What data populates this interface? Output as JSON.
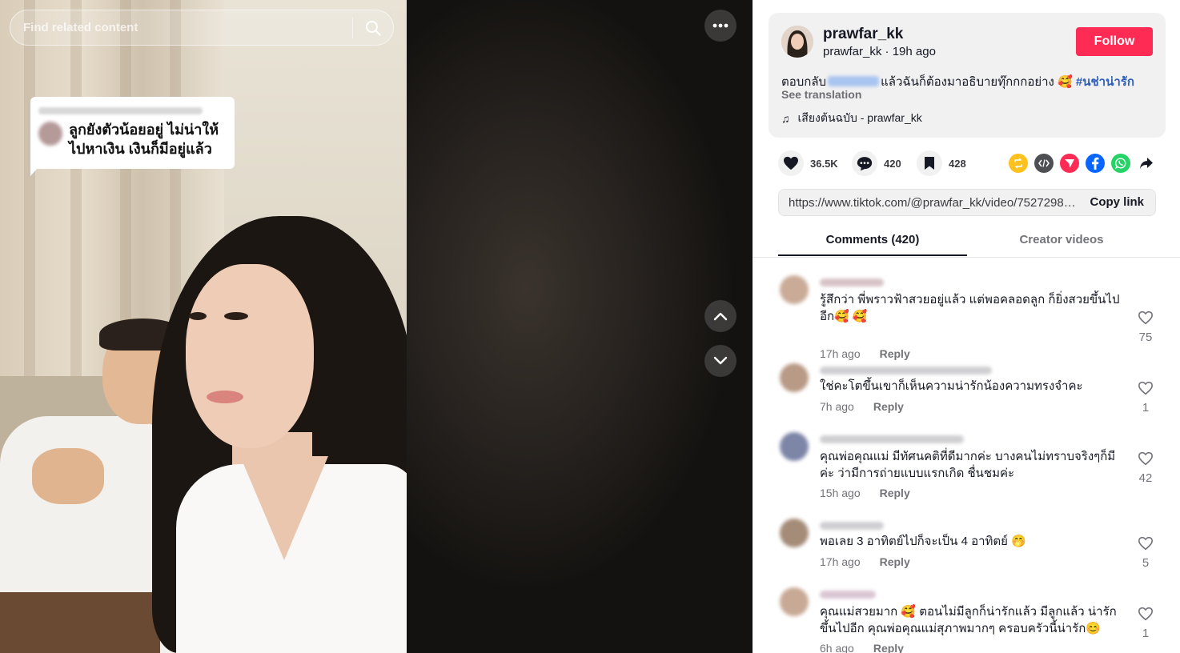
{
  "search": {
    "placeholder": "Find related content"
  },
  "overlay": {
    "comment_text": "ลูกยังตัวน้อยอยู่ ไม่น่าให้ไปหาเงิน เงินก็มีอยู่แล้ว"
  },
  "author": {
    "name": "prawfar_kk",
    "handle": "prawfar_kk",
    "separator": "·",
    "posted": "19h ago",
    "follow_label": "Follow"
  },
  "description": {
    "caption_prefix": "ตอบกลับ",
    "caption_body": "แล้วฉันก็ต้องมาอธิบายทุ๊กกกอย่าง 🥰",
    "hashtag": "#นช่าน่ารัก",
    "see_translation": "See translation",
    "music_icon": "♫",
    "music": "เสียงต้นฉบับ - prawfar_kk"
  },
  "stats": {
    "likes": "36.5K",
    "comments": "420",
    "saves": "428"
  },
  "share": {
    "icons": [
      "repost-icon",
      "embed-icon",
      "send-icon",
      "facebook-icon",
      "whatsapp-icon",
      "share-arrow-icon"
    ],
    "colors": {
      "repost": "#fec11d",
      "embed": "#4e4e55",
      "send": "#fe2c55",
      "facebook": "#0866ff",
      "whatsapp": "#25d366"
    }
  },
  "link": {
    "url": "https://www.tiktok.com/@prawfar_kk/video/75272989...",
    "copy_label": "Copy link"
  },
  "tabs": {
    "comments": "Comments (420)",
    "creator": "Creator videos"
  },
  "comments": [
    {
      "text": "รู้สึกว่า พี่พราวฟ้าสวยอยู่แล้ว แต่พอคลอดลูก ก็ยิ่งสวยขึ้นไปอีก🥰 🥰",
      "time": "17h ago",
      "reply": "Reply",
      "likes": "75"
    },
    {
      "text": "ใช่คะโตขึ้นเขาก็เห็นความน่ารักน้องความทรงจำคะ",
      "time": "7h ago",
      "reply": "Reply",
      "likes": "1"
    },
    {
      "text": "คุณพ่อคุณแม่ มีทัศนคติที่ดีมากค่ะ บางคนไม่ทราบจริงๆก็มีค่ะ ว่ามีการถ่ายแบบแรกเกิด ชื่นชมค่ะ",
      "time": "15h ago",
      "reply": "Reply",
      "likes": "42"
    },
    {
      "text": "พอเลย 3 อาทิตย์ไปก็จะเป็น 4 อาทิตย์ 🤭",
      "time": "17h ago",
      "reply": "Reply",
      "likes": "5"
    },
    {
      "text": "คุณแม่สวยมาก 🥰 ตอนไม่มีลูกก็น่ารักแล้ว มีลูกแล้ว น่ารักขึ้นไปอีก คุณพ่อคุณแม่สุภาพมากๆ ครอบครัวนี้น่ารัก😊",
      "time": "6h ago",
      "reply": "Reply",
      "likes": "1"
    }
  ]
}
